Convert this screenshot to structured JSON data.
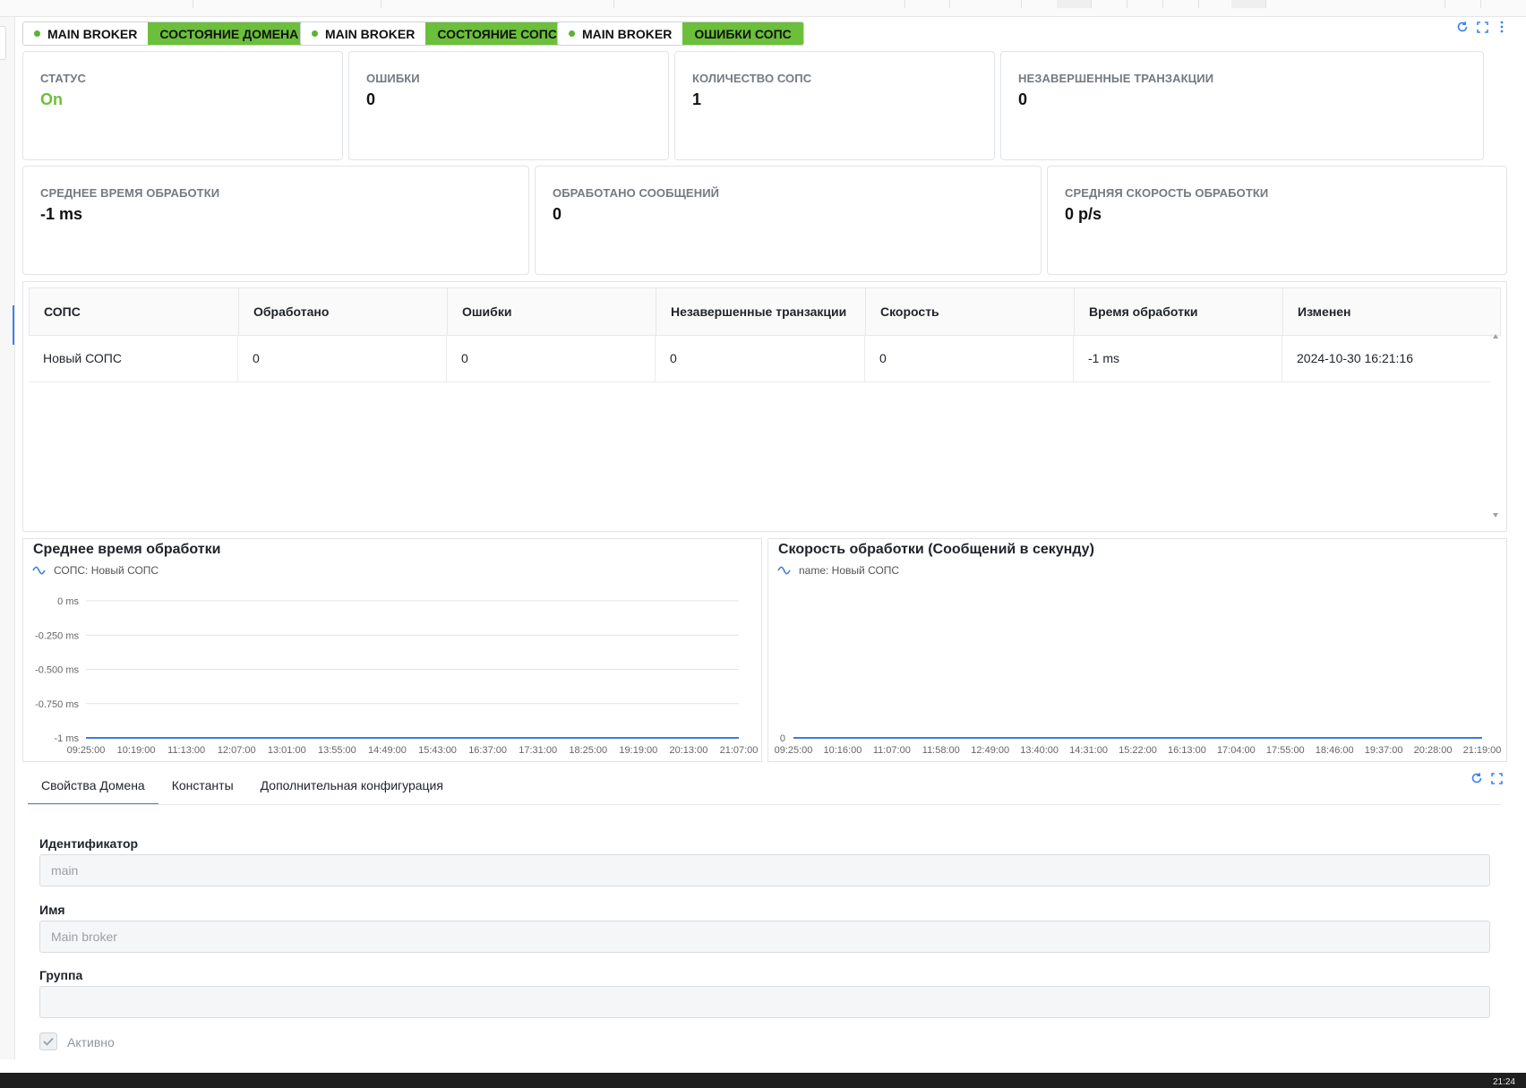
{
  "header": {
    "tags": [
      {
        "name": "MAIN BROKER",
        "badge": "СОСТОЯНИЕ ДОМЕНА"
      },
      {
        "name": "MAIN BROKER",
        "badge": "СОСТОЯНИЕ СОПС"
      },
      {
        "name": "MAIN BROKER",
        "badge": "ОШИБКИ СОПС"
      }
    ],
    "toolbar_icons": [
      "refresh-icon",
      "fullscreen-icon",
      "more-vertical-icon"
    ]
  },
  "stats_row1": [
    {
      "label": "СТАТУС",
      "value": "On"
    },
    {
      "label": "ОШИБКИ",
      "value": "0"
    },
    {
      "label": "КОЛИЧЕСТВО СОПС",
      "value": "1"
    },
    {
      "label": "НЕЗАВЕРШЕННЫЕ ТРАНЗАКЦИИ",
      "value": "0"
    }
  ],
  "stats_row2": [
    {
      "label": "СРЕДНЕЕ ВРЕМЯ ОБРАБОТКИ",
      "value": "-1 ms"
    },
    {
      "label": "ОБРАБОТАНО СООБЩЕНИЙ",
      "value": "0"
    },
    {
      "label": "СРЕДНЯЯ СКОРОСТЬ ОБРАБОТКИ",
      "value": "0 p/s"
    }
  ],
  "table": {
    "columns": [
      "СОПС",
      "Обработано",
      "Ошибки",
      "Незавершенные транзакции",
      "Скорость",
      "Время обработки",
      "Изменен"
    ],
    "rows": [
      [
        "Новый СОПС",
        "0",
        "0",
        "0",
        "0",
        "-1 ms",
        "2024-10-30 16:21:16"
      ]
    ]
  },
  "chart_data": [
    {
      "type": "line",
      "title": "Среднее время обработки",
      "series": [
        {
          "name": "СОПС: Новый СОПС",
          "values": [
            -1,
            -1,
            -1,
            -1,
            -1,
            -1,
            -1,
            -1,
            -1,
            -1,
            -1,
            -1,
            -1,
            -1
          ]
        }
      ],
      "x": [
        "09:25:00",
        "10:19:00",
        "11:13:00",
        "12:07:00",
        "13:01:00",
        "13:55:00",
        "14:49:00",
        "15:43:00",
        "16:37:00",
        "17:31:00",
        "18:25:00",
        "19:19:00",
        "20:13:00",
        "21:07:00"
      ],
      "yticks": [
        "0  ms",
        "-0.250  ms",
        "-0.500  ms",
        "-0.750  ms",
        "-1  ms"
      ],
      "ytick_values": [
        0,
        -0.25,
        -0.5,
        -0.75,
        -1
      ],
      "ylim": [
        -1,
        0
      ],
      "grid": true,
      "line_color": "#3b7ddd"
    },
    {
      "type": "line",
      "title": "Скорость обработки (Сообщений в секунду)",
      "series": [
        {
          "name": "name: Новый СОПС",
          "values": [
            0,
            0,
            0,
            0,
            0,
            0,
            0,
            0,
            0,
            0,
            0,
            0,
            0,
            0,
            0
          ]
        }
      ],
      "x": [
        "09:25:00",
        "10:16:00",
        "11:07:00",
        "11:58:00",
        "12:49:00",
        "13:40:00",
        "14:31:00",
        "15:22:00",
        "16:13:00",
        "17:04:00",
        "17:55:00",
        "18:46:00",
        "19:37:00",
        "20:28:00",
        "21:19:00"
      ],
      "yticks": [
        "0"
      ],
      "ytick_values": [
        0
      ],
      "ylim": [
        0,
        0
      ],
      "grid": false,
      "line_color": "#3b7ddd"
    }
  ],
  "form": {
    "tabs": [
      "Свойства Домена",
      "Константы",
      "Дополнительная конфигурация"
    ],
    "fields": [
      {
        "label": "Идентификатор",
        "value": "main"
      },
      {
        "label": "Имя",
        "value": "Main broker"
      },
      {
        "label": "Группа",
        "value": ""
      }
    ],
    "checkbox": {
      "label": "Активно",
      "checked": true
    },
    "toolbar_icons": [
      "refresh-icon",
      "fullscreen-icon"
    ]
  },
  "taskbar": {
    "time": "21:24"
  }
}
